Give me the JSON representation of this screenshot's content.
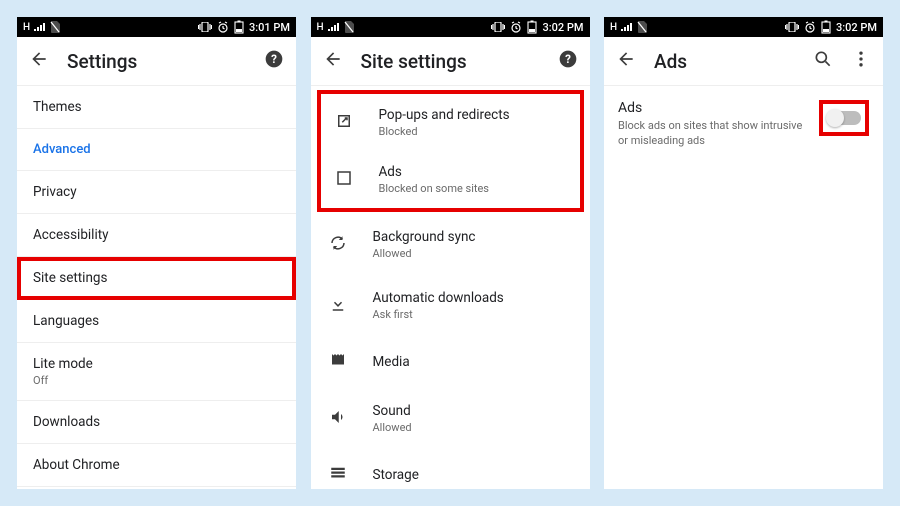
{
  "screens": [
    {
      "statusbar": {
        "signal_label": "H",
        "time": "3:01 PM"
      },
      "appbar": {
        "title": "Settings",
        "has_back": true,
        "has_help": true,
        "has_search": false,
        "has_overflow": false
      },
      "items": [
        {
          "label": "Themes",
          "sub": "",
          "section": false,
          "highlight": false
        },
        {
          "label": "Advanced",
          "sub": "",
          "section": true,
          "highlight": false
        },
        {
          "label": "Privacy",
          "sub": "",
          "section": false,
          "highlight": false
        },
        {
          "label": "Accessibility",
          "sub": "",
          "section": false,
          "highlight": false
        },
        {
          "label": "Site settings",
          "sub": "",
          "section": false,
          "highlight": true
        },
        {
          "label": "Languages",
          "sub": "",
          "section": false,
          "highlight": false
        },
        {
          "label": "Lite mode",
          "sub": "Off",
          "section": false,
          "highlight": false
        },
        {
          "label": "Downloads",
          "sub": "",
          "section": false,
          "highlight": false
        },
        {
          "label": "About Chrome",
          "sub": "",
          "section": false,
          "highlight": false
        }
      ]
    },
    {
      "statusbar": {
        "signal_label": "H",
        "time": "3:02 PM"
      },
      "appbar": {
        "title": "Site settings",
        "has_back": true,
        "has_help": true,
        "has_search": false,
        "has_overflow": false
      },
      "highlighted_group": [
        {
          "icon": "popup-icon",
          "label": "Pop-ups and redirects",
          "sub": "Blocked"
        },
        {
          "icon": "ads-icon",
          "label": "Ads",
          "sub": "Blocked on some sites"
        }
      ],
      "items": [
        {
          "icon": "sync-icon",
          "label": "Background sync",
          "sub": "Allowed"
        },
        {
          "icon": "download-icon",
          "label": "Automatic downloads",
          "sub": "Ask first"
        },
        {
          "icon": "media-icon",
          "label": "Media",
          "sub": ""
        },
        {
          "icon": "sound-icon",
          "label": "Sound",
          "sub": "Allowed"
        },
        {
          "icon": "storage-icon",
          "label": "Storage",
          "sub": ""
        }
      ]
    },
    {
      "statusbar": {
        "signal_label": "H",
        "time": "3:02 PM"
      },
      "appbar": {
        "title": "Ads",
        "has_back": true,
        "has_help": false,
        "has_search": true,
        "has_overflow": true
      },
      "ads": {
        "label": "Ads",
        "sub": "Block ads on sites that show intrusive or misleading ads",
        "toggle_on": false
      }
    }
  ]
}
